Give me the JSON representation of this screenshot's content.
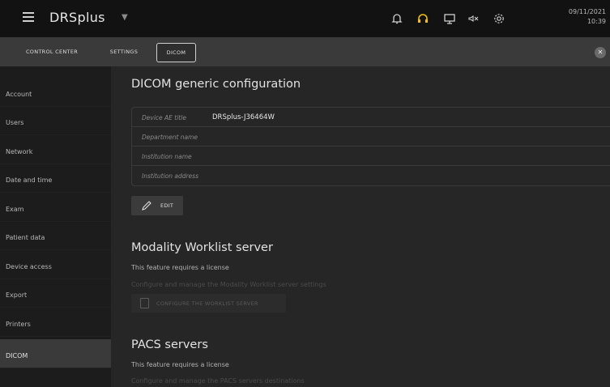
{
  "app": {
    "title": "DRSplus"
  },
  "header": {
    "date": "09/11/2021",
    "time": "10:39"
  },
  "tabs": [
    {
      "label": "CONTROL CENTER"
    },
    {
      "label": "SETTINGS"
    },
    {
      "label": "DICOM"
    }
  ],
  "sidebar": {
    "items": [
      {
        "label": "Account"
      },
      {
        "label": "Users"
      },
      {
        "label": "Network"
      },
      {
        "label": "Date and time"
      },
      {
        "label": "Exam"
      },
      {
        "label": "Patient data"
      },
      {
        "label": "Device access"
      },
      {
        "label": "Export"
      },
      {
        "label": "Printers"
      },
      {
        "label": "DICOM"
      }
    ],
    "active": "DICOM"
  },
  "dicom_generic": {
    "title": "DICOM generic configuration",
    "fields": [
      {
        "label": "Device AE title",
        "value": "DRSplus-J36464W"
      },
      {
        "label": "Department name",
        "value": ""
      },
      {
        "label": "Institution name",
        "value": ""
      },
      {
        "label": "Institution address",
        "value": ""
      }
    ],
    "edit_label": "EDIT"
  },
  "worklist": {
    "title": "Modality Worklist server",
    "license": "This feature requires a license",
    "description": "Configure and manage the Modality Worklist server settings",
    "button_label": "CONFIGURE THE WORKLIST SERVER"
  },
  "pacs": {
    "title": "PACS servers",
    "license": "This feature requires a license",
    "description": "Configure and manage the PACS servers destinations"
  },
  "colors": {
    "headset_accent": "#f2c200",
    "active_tab_border": "#cfcfcf"
  }
}
